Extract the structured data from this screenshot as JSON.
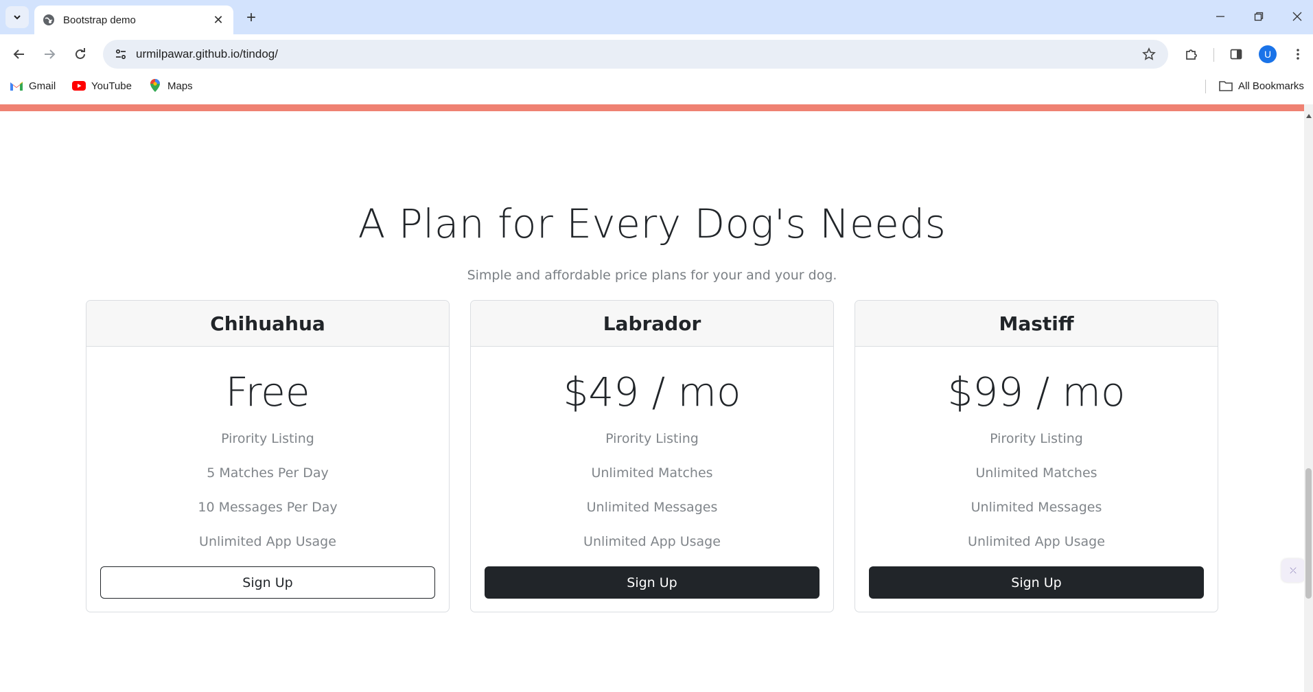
{
  "browser": {
    "tab_title": "Bootstrap demo",
    "url": "urmilpawar.github.io/tindog/",
    "profile_initial": "U",
    "bookmarks": [
      {
        "label": "Gmail",
        "icon": "gmail-icon"
      },
      {
        "label": "YouTube",
        "icon": "youtube-icon"
      },
      {
        "label": "Maps",
        "icon": "maps-icon"
      }
    ],
    "all_bookmarks_label": "All Bookmarks"
  },
  "pricing": {
    "heading": "A Plan for Every Dog's Needs",
    "subheading": "Simple and affordable price plans for your and your dog.",
    "plans": [
      {
        "name": "Chihuahua",
        "price": "Free",
        "features": [
          "Pirority Listing",
          "5 Matches Per Day",
          "10 Messages Per Day",
          "Unlimited App Usage"
        ],
        "button_label": "Sign Up",
        "button_style": "outline"
      },
      {
        "name": "Labrador",
        "price": "$49 / mo",
        "features": [
          "Pirority Listing",
          "Unlimited Matches",
          "Unlimited Messages",
          "Unlimited App Usage"
        ],
        "button_label": "Sign Up",
        "button_style": "dark"
      },
      {
        "name": "Mastiff",
        "price": "$99 / mo",
        "features": [
          "Pirority Listing",
          "Unlimited Matches",
          "Unlimited Messages",
          "Unlimited App Usage"
        ],
        "button_label": "Sign Up",
        "button_style": "dark"
      }
    ]
  },
  "colors": {
    "accent_bar": "#ef8172",
    "dark_button": "#212529",
    "tabstrip": "#d3e3fd"
  }
}
